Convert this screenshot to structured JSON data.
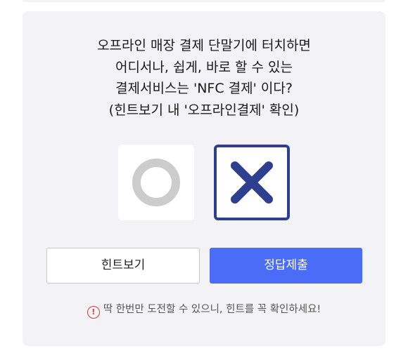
{
  "quiz": {
    "question_lines": [
      "오프라인 매장 결제 단말기에 터치하면",
      "어디서나, 쉽게, 바로 할 수 있는",
      "결제서비스는 'NFC 결제' 이다?",
      "(힌트보기 내 '오프라인결제' 확인)"
    ],
    "options": {
      "o_icon": "circle-o-icon",
      "x_icon": "x-mark-icon",
      "selected": "X"
    }
  },
  "buttons": {
    "hint_label": "힌트보기",
    "submit_label": "정답제출"
  },
  "notice": {
    "icon": "exclamation-circle-icon",
    "text": "딱 한번만 도전할 수 있으니, 힌트를 꼭 확인하세요!"
  },
  "colors": {
    "accent": "#4a6cf7",
    "selected_border": "#2e3f8f",
    "x_mark": "#2e3f8f",
    "o_mark": "#cccccc",
    "warning": "#d23b3b",
    "card_bg": "#f3f3f5"
  }
}
